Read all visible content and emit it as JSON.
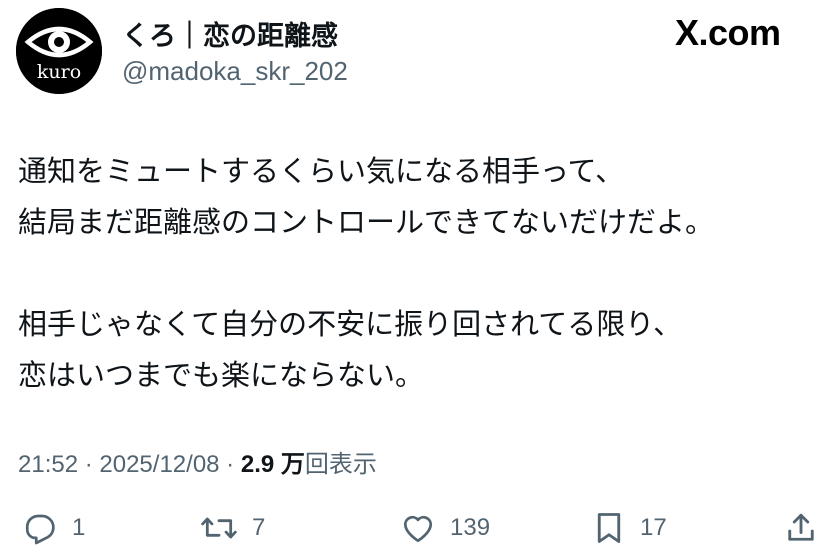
{
  "author": {
    "display_name": "くろ｜恋の距離感",
    "handle": "@madoka_skr_202",
    "avatar_text": "kuro"
  },
  "source": "X.com",
  "tweet": {
    "lines_paragraph1": [
      "通知をミュートするくらい気になる相手って、",
      "結局まだ距離感のコントロールできてないだけだよ。"
    ],
    "lines_paragraph2": [
      "相手じゃなくて自分の不安に振り回されてる限り、",
      "恋はいつまでも楽にならない。"
    ]
  },
  "meta": {
    "time": "21:52",
    "separator": " · ",
    "date": "2025/12/08",
    "views_count": "2.9 万",
    "views_label": "回表示"
  },
  "actions": {
    "reply_count": "1",
    "retweet_count": "7",
    "like_count": "139",
    "bookmark_count": "17"
  },
  "icons": {
    "reply": "reply-icon",
    "retweet": "retweet-icon",
    "like": "heart-icon",
    "bookmark": "bookmark-icon",
    "share": "share-icon"
  },
  "colors": {
    "text": "#0f1419",
    "secondary": "#536471",
    "avatar_bg": "#000000"
  }
}
